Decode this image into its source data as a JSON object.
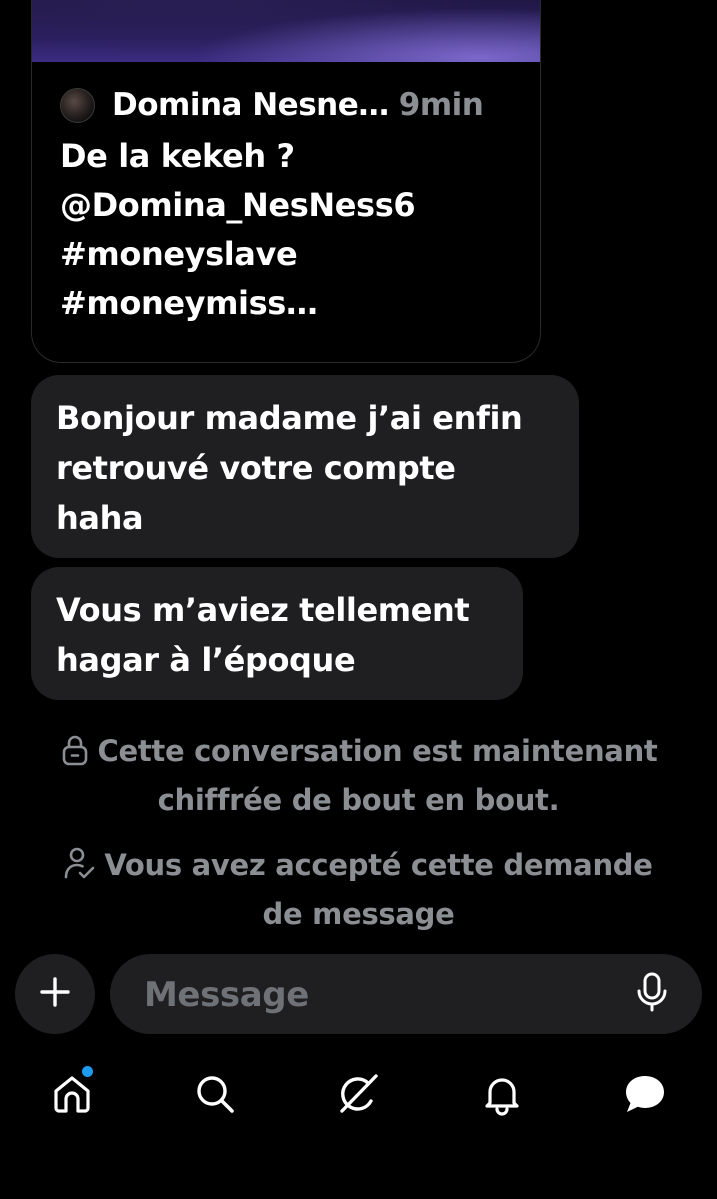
{
  "tweet": {
    "author": "Domina Nesne…",
    "time": "9min",
    "lines": [
      "De la kekeh ?",
      "@Domina_NesNess6",
      "#moneyslave",
      "#moneymiss…"
    ]
  },
  "messages": [
    {
      "lines": [
        "Bonjour madame j’ai enfin",
        "retrouvé votre compte",
        "haha"
      ]
    },
    {
      "lines": [
        "Vous m’aviez tellement",
        "hagar à l’époque"
      ]
    }
  ],
  "notices": {
    "encrypted": {
      "icon": "lock-icon",
      "line1": "Cette conversation est maintenant",
      "line2": "chiffrée de bout en bout."
    },
    "accepted": {
      "icon": "person-check-icon",
      "line1": "Vous avez accepté cette demande",
      "line2": "de message"
    }
  },
  "composer": {
    "add_icon": "plus-icon",
    "placeholder": "Message",
    "mic_icon": "microphone-icon"
  },
  "nav": {
    "items": [
      {
        "name": "home",
        "icon": "home-icon",
        "has_dot": true
      },
      {
        "name": "search",
        "icon": "search-icon"
      },
      {
        "name": "grok",
        "icon": "grok-icon"
      },
      {
        "name": "notifications",
        "icon": "bell-icon"
      },
      {
        "name": "messages",
        "icon": "message-bubble-icon",
        "active": true
      }
    ]
  },
  "colors": {
    "background": "#000000",
    "bubble": "#1f1f21",
    "muted_text": "#8b8f94",
    "notification_dot": "#1d9bf0"
  }
}
